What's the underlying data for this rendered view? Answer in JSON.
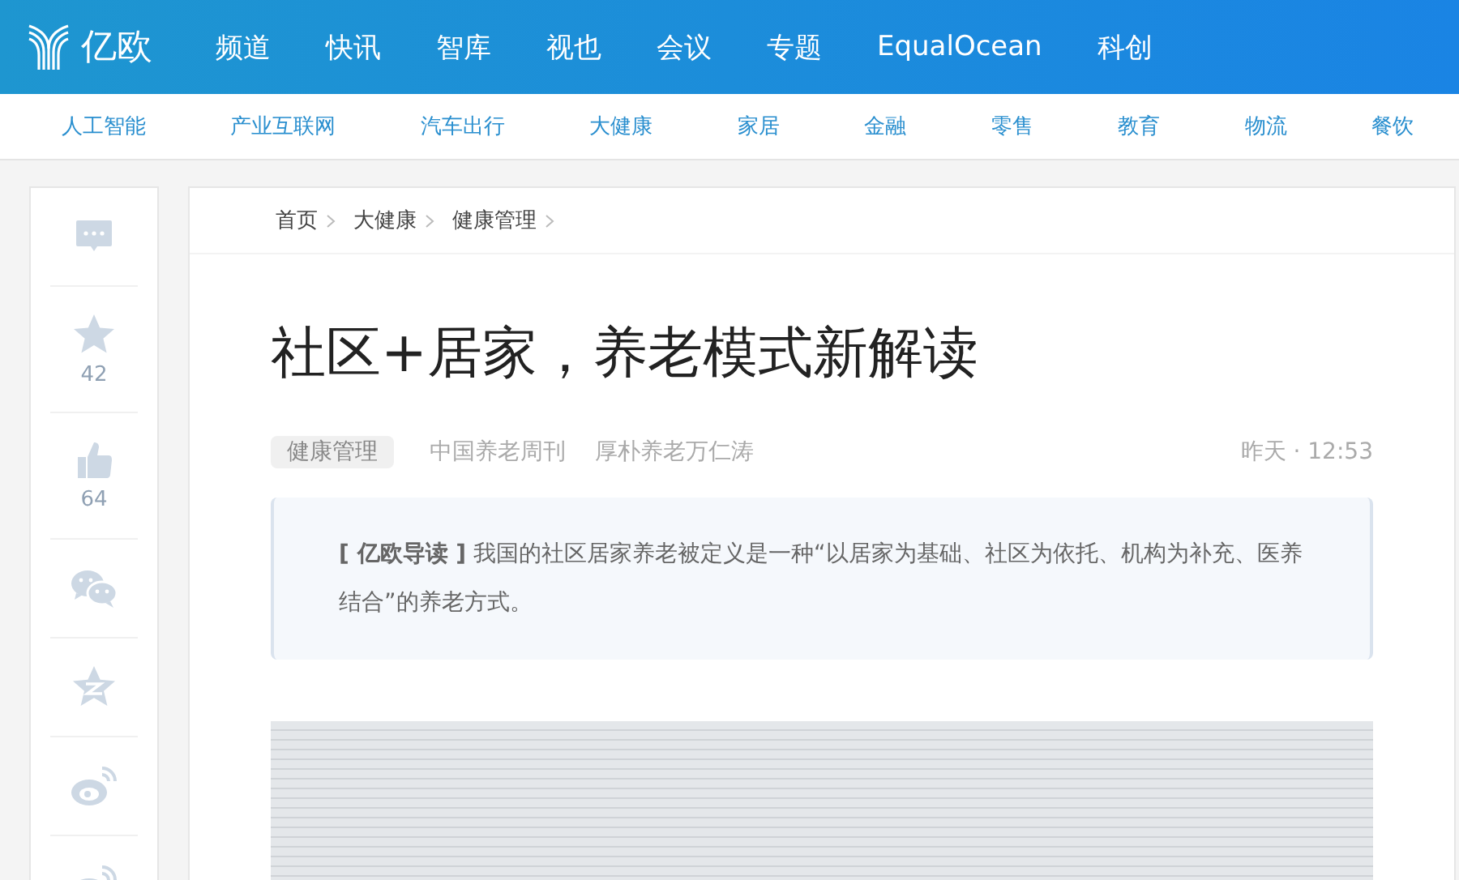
{
  "header": {
    "logo_text": "亿欧",
    "nav": [
      {
        "label": "频道"
      },
      {
        "label": "快讯"
      },
      {
        "label": "智库"
      },
      {
        "label": "视也"
      },
      {
        "label": "会议"
      },
      {
        "label": "专题"
      },
      {
        "label": "EqualOcean"
      },
      {
        "label": "科创"
      }
    ]
  },
  "subnav": [
    {
      "label": "人工智能"
    },
    {
      "label": "产业互联网"
    },
    {
      "label": "汽车出行"
    },
    {
      "label": "大健康"
    },
    {
      "label": "家居"
    },
    {
      "label": "金融"
    },
    {
      "label": "零售"
    },
    {
      "label": "教育"
    },
    {
      "label": "物流"
    },
    {
      "label": "餐饮"
    }
  ],
  "sidebar": {
    "items": [
      {
        "kind": "comment"
      },
      {
        "kind": "star",
        "count": "42"
      },
      {
        "kind": "like",
        "count": "64"
      },
      {
        "kind": "wechat"
      },
      {
        "kind": "qzone"
      },
      {
        "kind": "weibo"
      },
      {
        "kind": "weibo2"
      }
    ]
  },
  "breadcrumb": [
    {
      "label": "首页"
    },
    {
      "label": "大健康"
    },
    {
      "label": "健康管理"
    }
  ],
  "article": {
    "title": "社区+居家，养老模式新解读",
    "tag": "健康管理",
    "source": "中国养老周刊",
    "author": "厚朴养老万仁涛",
    "time": "昨天 · 12:53",
    "lead": "**[ 亿欧导读 ]** 我国的社区居家养老被定义是一种“以居家为基础、社区为依托、机构为补充、医养结合”的养老方式。"
  }
}
